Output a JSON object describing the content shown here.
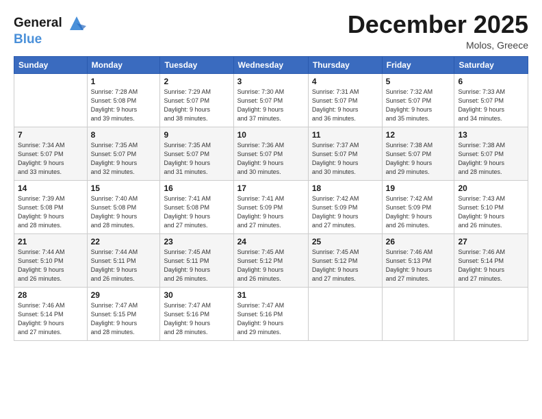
{
  "header": {
    "logo_line1": "General",
    "logo_line2": "Blue",
    "month": "December 2025",
    "location": "Molos, Greece"
  },
  "weekdays": [
    "Sunday",
    "Monday",
    "Tuesday",
    "Wednesday",
    "Thursday",
    "Friday",
    "Saturday"
  ],
  "weeks": [
    [
      {
        "day": "",
        "info": ""
      },
      {
        "day": "1",
        "info": "Sunrise: 7:28 AM\nSunset: 5:08 PM\nDaylight: 9 hours\nand 39 minutes."
      },
      {
        "day": "2",
        "info": "Sunrise: 7:29 AM\nSunset: 5:07 PM\nDaylight: 9 hours\nand 38 minutes."
      },
      {
        "day": "3",
        "info": "Sunrise: 7:30 AM\nSunset: 5:07 PM\nDaylight: 9 hours\nand 37 minutes."
      },
      {
        "day": "4",
        "info": "Sunrise: 7:31 AM\nSunset: 5:07 PM\nDaylight: 9 hours\nand 36 minutes."
      },
      {
        "day": "5",
        "info": "Sunrise: 7:32 AM\nSunset: 5:07 PM\nDaylight: 9 hours\nand 35 minutes."
      },
      {
        "day": "6",
        "info": "Sunrise: 7:33 AM\nSunset: 5:07 PM\nDaylight: 9 hours\nand 34 minutes."
      }
    ],
    [
      {
        "day": "7",
        "info": "Sunrise: 7:34 AM\nSunset: 5:07 PM\nDaylight: 9 hours\nand 33 minutes."
      },
      {
        "day": "8",
        "info": "Sunrise: 7:35 AM\nSunset: 5:07 PM\nDaylight: 9 hours\nand 32 minutes."
      },
      {
        "day": "9",
        "info": "Sunrise: 7:35 AM\nSunset: 5:07 PM\nDaylight: 9 hours\nand 31 minutes."
      },
      {
        "day": "10",
        "info": "Sunrise: 7:36 AM\nSunset: 5:07 PM\nDaylight: 9 hours\nand 30 minutes."
      },
      {
        "day": "11",
        "info": "Sunrise: 7:37 AM\nSunset: 5:07 PM\nDaylight: 9 hours\nand 30 minutes."
      },
      {
        "day": "12",
        "info": "Sunrise: 7:38 AM\nSunset: 5:07 PM\nDaylight: 9 hours\nand 29 minutes."
      },
      {
        "day": "13",
        "info": "Sunrise: 7:38 AM\nSunset: 5:07 PM\nDaylight: 9 hours\nand 28 minutes."
      }
    ],
    [
      {
        "day": "14",
        "info": "Sunrise: 7:39 AM\nSunset: 5:08 PM\nDaylight: 9 hours\nand 28 minutes."
      },
      {
        "day": "15",
        "info": "Sunrise: 7:40 AM\nSunset: 5:08 PM\nDaylight: 9 hours\nand 28 minutes."
      },
      {
        "day": "16",
        "info": "Sunrise: 7:41 AM\nSunset: 5:08 PM\nDaylight: 9 hours\nand 27 minutes."
      },
      {
        "day": "17",
        "info": "Sunrise: 7:41 AM\nSunset: 5:09 PM\nDaylight: 9 hours\nand 27 minutes."
      },
      {
        "day": "18",
        "info": "Sunrise: 7:42 AM\nSunset: 5:09 PM\nDaylight: 9 hours\nand 27 minutes."
      },
      {
        "day": "19",
        "info": "Sunrise: 7:42 AM\nSunset: 5:09 PM\nDaylight: 9 hours\nand 26 minutes."
      },
      {
        "day": "20",
        "info": "Sunrise: 7:43 AM\nSunset: 5:10 PM\nDaylight: 9 hours\nand 26 minutes."
      }
    ],
    [
      {
        "day": "21",
        "info": "Sunrise: 7:44 AM\nSunset: 5:10 PM\nDaylight: 9 hours\nand 26 minutes."
      },
      {
        "day": "22",
        "info": "Sunrise: 7:44 AM\nSunset: 5:11 PM\nDaylight: 9 hours\nand 26 minutes."
      },
      {
        "day": "23",
        "info": "Sunrise: 7:45 AM\nSunset: 5:11 PM\nDaylight: 9 hours\nand 26 minutes."
      },
      {
        "day": "24",
        "info": "Sunrise: 7:45 AM\nSunset: 5:12 PM\nDaylight: 9 hours\nand 26 minutes."
      },
      {
        "day": "25",
        "info": "Sunrise: 7:45 AM\nSunset: 5:12 PM\nDaylight: 9 hours\nand 27 minutes."
      },
      {
        "day": "26",
        "info": "Sunrise: 7:46 AM\nSunset: 5:13 PM\nDaylight: 9 hours\nand 27 minutes."
      },
      {
        "day": "27",
        "info": "Sunrise: 7:46 AM\nSunset: 5:14 PM\nDaylight: 9 hours\nand 27 minutes."
      }
    ],
    [
      {
        "day": "28",
        "info": "Sunrise: 7:46 AM\nSunset: 5:14 PM\nDaylight: 9 hours\nand 27 minutes."
      },
      {
        "day": "29",
        "info": "Sunrise: 7:47 AM\nSunset: 5:15 PM\nDaylight: 9 hours\nand 28 minutes."
      },
      {
        "day": "30",
        "info": "Sunrise: 7:47 AM\nSunset: 5:16 PM\nDaylight: 9 hours\nand 28 minutes."
      },
      {
        "day": "31",
        "info": "Sunrise: 7:47 AM\nSunset: 5:16 PM\nDaylight: 9 hours\nand 29 minutes."
      },
      {
        "day": "",
        "info": ""
      },
      {
        "day": "",
        "info": ""
      },
      {
        "day": "",
        "info": ""
      }
    ]
  ]
}
